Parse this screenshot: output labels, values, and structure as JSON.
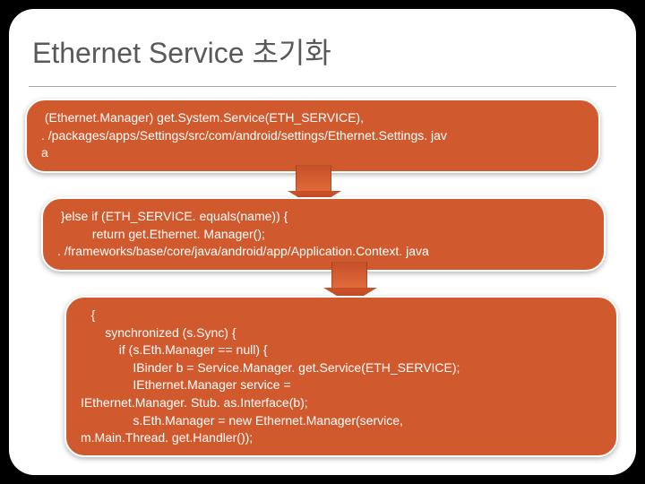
{
  "title": "Ethernet Service 초기화",
  "box1": " (Ethernet.Manager) get.System.Service(ETH_SERVICE),\n. /packages/apps/Settings/src/com/android/settings/Ethernet.Settings. jav\na",
  "box2": " }else if (ETH_SERVICE. equals(name)) {\n          return get.Ethernet. Manager();\n. /frameworks/base/core/java/android/app/Application.Context. java",
  "box3": "   {\n       synchronized (s.Sync) {\n           if (s.Eth.Manager == null) {\n               IBinder b = Service.Manager. get.Service(ETH_SERVICE);\n               IEthernet.Manager service =\nIEthernet.Manager. Stub. as.Interface(b);\n               s.Eth.Manager = new Ethernet.Manager(service,\nm.Main.Thread. get.Handler());"
}
